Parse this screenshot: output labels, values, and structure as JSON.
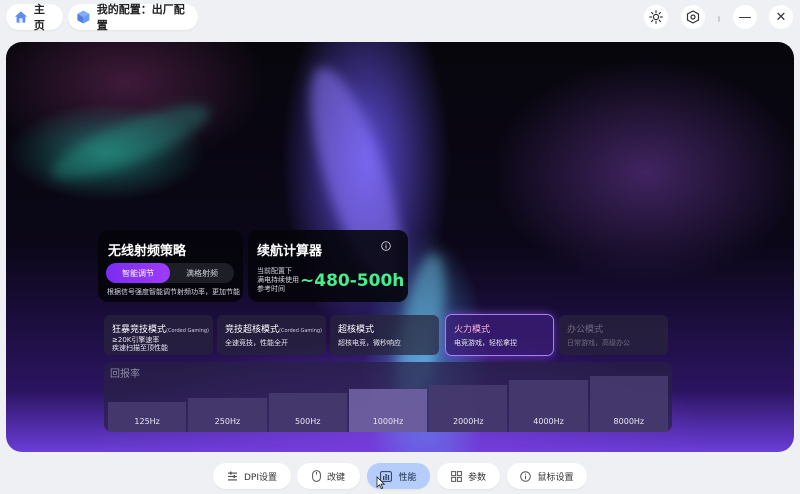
{
  "header": {
    "home_label": "主页",
    "profile_label": "我的配置：出厂配置"
  },
  "toolbar": {
    "brightness_icon": "sun-icon",
    "settings_icon": "hex-settings-icon",
    "minimize_glyph": "—",
    "close_glyph": "✕"
  },
  "wireless": {
    "title": "无线射频策略",
    "options": [
      "智能调节",
      "满格射频"
    ],
    "selected": "智能调节",
    "note": "根据信号强度智能调节射频功率，更加节能"
  },
  "battery_calc": {
    "title": "续航计算器",
    "note_lines": [
      "当前配置下",
      "满电持续使用",
      "参考时间"
    ],
    "value": "~480-500h"
  },
  "modes": [
    {
      "title": "狂暴竞技模式",
      "tag": "(Corded Gaming)",
      "desc": [
        "≥20K引擎速率",
        "疾速扫描至顶性能"
      ],
      "state": "normal"
    },
    {
      "title": "竞技超核模式",
      "tag": "(Corded Gaming)",
      "desc": [
        "全速竞技，性能全开"
      ],
      "state": "normal"
    },
    {
      "title": "超核模式",
      "tag": "",
      "desc": [
        "超核电竞，微秒响应"
      ],
      "state": "normal"
    },
    {
      "title": "火力模式",
      "tag": "",
      "desc": [
        "电竞游戏，轻松拿捏"
      ],
      "state": "active"
    },
    {
      "title": "办公模式",
      "tag": "",
      "desc": [
        "日常游戏，高级办公"
      ],
      "state": "disabled"
    }
  ],
  "polling": {
    "label": "回报率",
    "rates": [
      "125Hz",
      "250Hz",
      "500Hz",
      "1000Hz",
      "2000Hz",
      "4000Hz",
      "8000Hz"
    ],
    "selected": "1000Hz"
  },
  "nav": {
    "items": [
      {
        "label": "DPI设置",
        "icon": "dpi-icon"
      },
      {
        "label": "改键",
        "icon": "mouse-icon"
      },
      {
        "label": "性能",
        "icon": "performance-icon"
      },
      {
        "label": "参数",
        "icon": "grid-icon"
      },
      {
        "label": "鼠标设置",
        "icon": "info-icon"
      }
    ],
    "active": "性能"
  },
  "colors": {
    "accent": "#9d3cff",
    "battery_value": "#44ef8e",
    "nav_active": "#b5cdfa"
  }
}
